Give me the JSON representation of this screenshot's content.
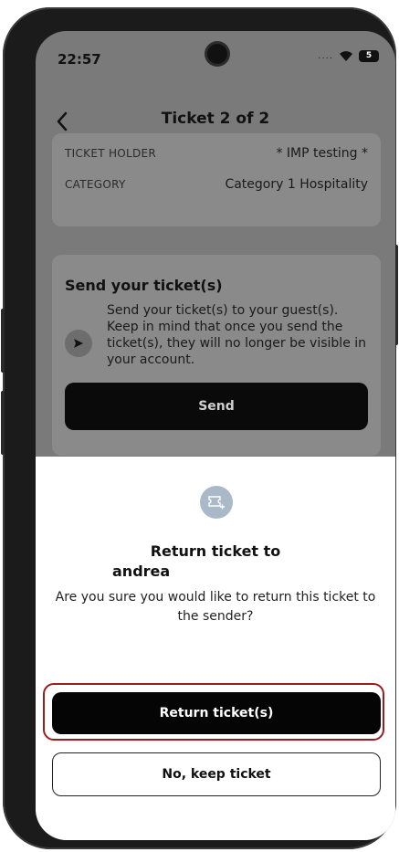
{
  "status": {
    "time": "22:57",
    "signal": "....",
    "battery": "5",
    "icons": [
      "wifi-icon",
      "battery-icon"
    ]
  },
  "header": {
    "title": "Ticket 2 of 2",
    "back_icon": "chevron-left-icon",
    "pager": {
      "total": 2,
      "active": 2
    }
  },
  "details": {
    "rows": [
      {
        "label": "TICKET HOLDER",
        "value": "* IMP testing  *"
      },
      {
        "label": "CATEGORY",
        "value": "Category 1 Hospitality"
      }
    ]
  },
  "send_card": {
    "title": "Send your ticket(s)",
    "description": "Send your ticket(s) to your guest(s). Keep in mind that once you send the ticket(s), they will no longer be visible in your account.",
    "icon": "send-arrow-icon",
    "button_label": "Send"
  },
  "sheet": {
    "icon": "ticket-return-icon",
    "title": "Return ticket to",
    "name": "andrea",
    "question": "Are you sure you would like to return this ticket to the sender?",
    "primary_label": "Return ticket(s)",
    "secondary_label": "No, keep ticket"
  },
  "colors": {
    "overlay_gray": "#7a7a7a",
    "card_gray": "#8a8a8a",
    "primary_black": "#050505",
    "highlight_red": "#9b1c1c",
    "icon_circle": "#a9b9c7"
  }
}
